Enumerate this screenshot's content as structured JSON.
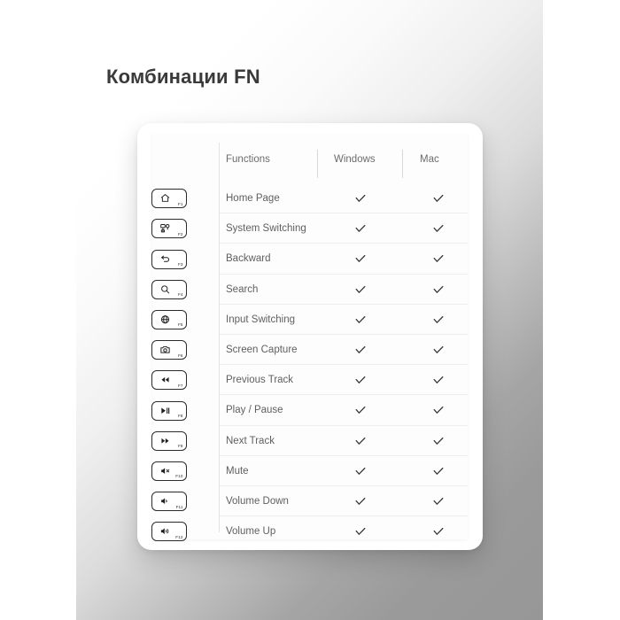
{
  "page": {
    "title": "Комбинации FN",
    "background_start": "#ffffff",
    "background_end": "#979797",
    "card_color": "#ffffff",
    "text_color": "#5f5f5f",
    "header_text_color": "#6c6c6c"
  },
  "table": {
    "columns": [
      "Functions",
      "Windows",
      "Mac"
    ],
    "rows": [
      {
        "key": "F1",
        "icon": "home-icon",
        "function": "Home Page",
        "windows": "check",
        "mac": "check"
      },
      {
        "key": "F2",
        "icon": "system-switch-icon",
        "function": "System Switching",
        "windows": "check",
        "mac": "check"
      },
      {
        "key": "F3",
        "icon": "back-arrow-icon",
        "function": "Backward",
        "windows": "check",
        "mac": "check"
      },
      {
        "key": "F4",
        "icon": "search-icon",
        "function": "Search",
        "windows": "check",
        "mac": "check"
      },
      {
        "key": "F5",
        "icon": "globe-icon",
        "function": "Input Switching",
        "windows": "check",
        "mac": "check"
      },
      {
        "key": "F6",
        "icon": "camera-icon",
        "function": "Screen Capture",
        "windows": "check",
        "mac": "check"
      },
      {
        "key": "F7",
        "icon": "rewind-icon",
        "function": "Previous Track",
        "windows": "check",
        "mac": "check"
      },
      {
        "key": "F8",
        "icon": "play-pause-icon",
        "function": "Play / Pause",
        "windows": "check",
        "mac": "check"
      },
      {
        "key": "F9",
        "icon": "fast-forward-icon",
        "function": "Next Track",
        "windows": "check",
        "mac": "check"
      },
      {
        "key": "F10",
        "icon": "volume-mute-icon",
        "function": "Mute",
        "windows": "check",
        "mac": "check"
      },
      {
        "key": "F11",
        "icon": "volume-down-icon",
        "function": "Volume Down",
        "windows": "check",
        "mac": "check"
      },
      {
        "key": "F12",
        "icon": "volume-up-icon",
        "function": "Volume Up",
        "windows": "check",
        "mac": "check"
      }
    ]
  }
}
